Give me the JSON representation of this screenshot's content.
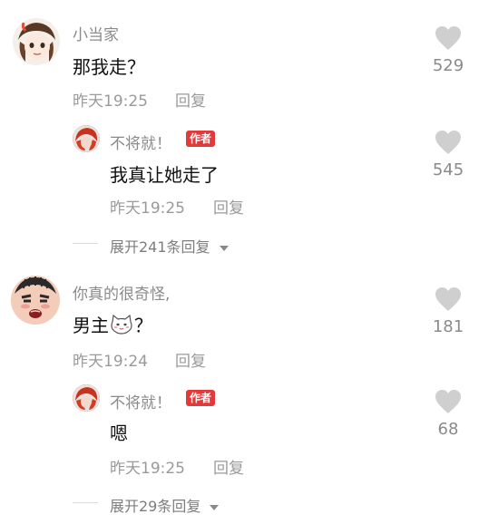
{
  "comments": [
    {
      "username": "小当家",
      "content": "那我走？",
      "time": "昨天19:25",
      "reply_label": "回复",
      "likes": "529",
      "replies": [
        {
          "username": "不将就！",
          "badge": "作者",
          "content": "我真让她走了",
          "time": "昨天19:25",
          "reply_label": "回复",
          "likes": "545"
        }
      ],
      "expand_label": "展开241条回复"
    },
    {
      "username": "你真的很奇怪,",
      "content_prefix": "男主",
      "content_suffix": "？",
      "time": "昨天19:24",
      "reply_label": "回复",
      "likes": "181",
      "replies": [
        {
          "username": "不将就！",
          "badge": "作者",
          "content": "嗯",
          "time": "昨天19:25",
          "reply_label": "回复",
          "likes": "68"
        }
      ],
      "expand_label": "展开29条回复"
    }
  ],
  "icons": {
    "like": "heart-icon",
    "expand": "chevron-down-icon",
    "emoji": "cat-face-emoji-icon"
  },
  "colors": {
    "badge_bg": "#e23a3a",
    "heart": "#cfcfcf",
    "meta_text": "#9a9a9a"
  }
}
